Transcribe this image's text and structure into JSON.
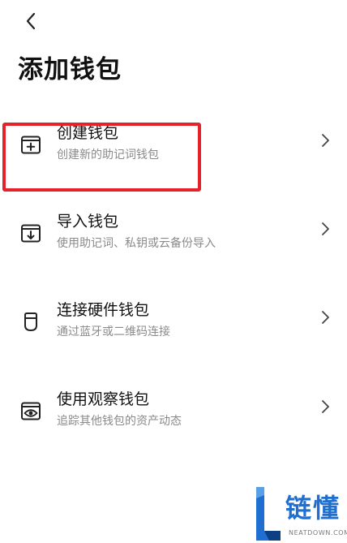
{
  "header": {
    "back_icon": "chevron-left-icon",
    "title": "添加钱包"
  },
  "menu": {
    "items": [
      {
        "key": "create",
        "icon": "folder-plus-icon",
        "title": "创建钱包",
        "subtitle": "创建新的助记词钱包",
        "highlighted": true
      },
      {
        "key": "import",
        "icon": "folder-import-icon",
        "title": "导入钱包",
        "subtitle": "使用助记词、私钥或云备份导入"
      },
      {
        "key": "hardware",
        "icon": "hardware-wallet-icon",
        "title": "连接硬件钱包",
        "subtitle": "通过蓝牙或二维码连接"
      },
      {
        "key": "watch",
        "icon": "eye-icon",
        "title": "使用观察钱包",
        "subtitle": "追踪其他钱包的资产动态"
      }
    ],
    "chevron_icon": "chevron-right-icon"
  },
  "annotation": {
    "highlight_color": "#e5222a"
  },
  "watermark": {
    "brand": "链懂",
    "url": "NEATDOWN.COM",
    "brand_color": "#1f6fd0"
  }
}
